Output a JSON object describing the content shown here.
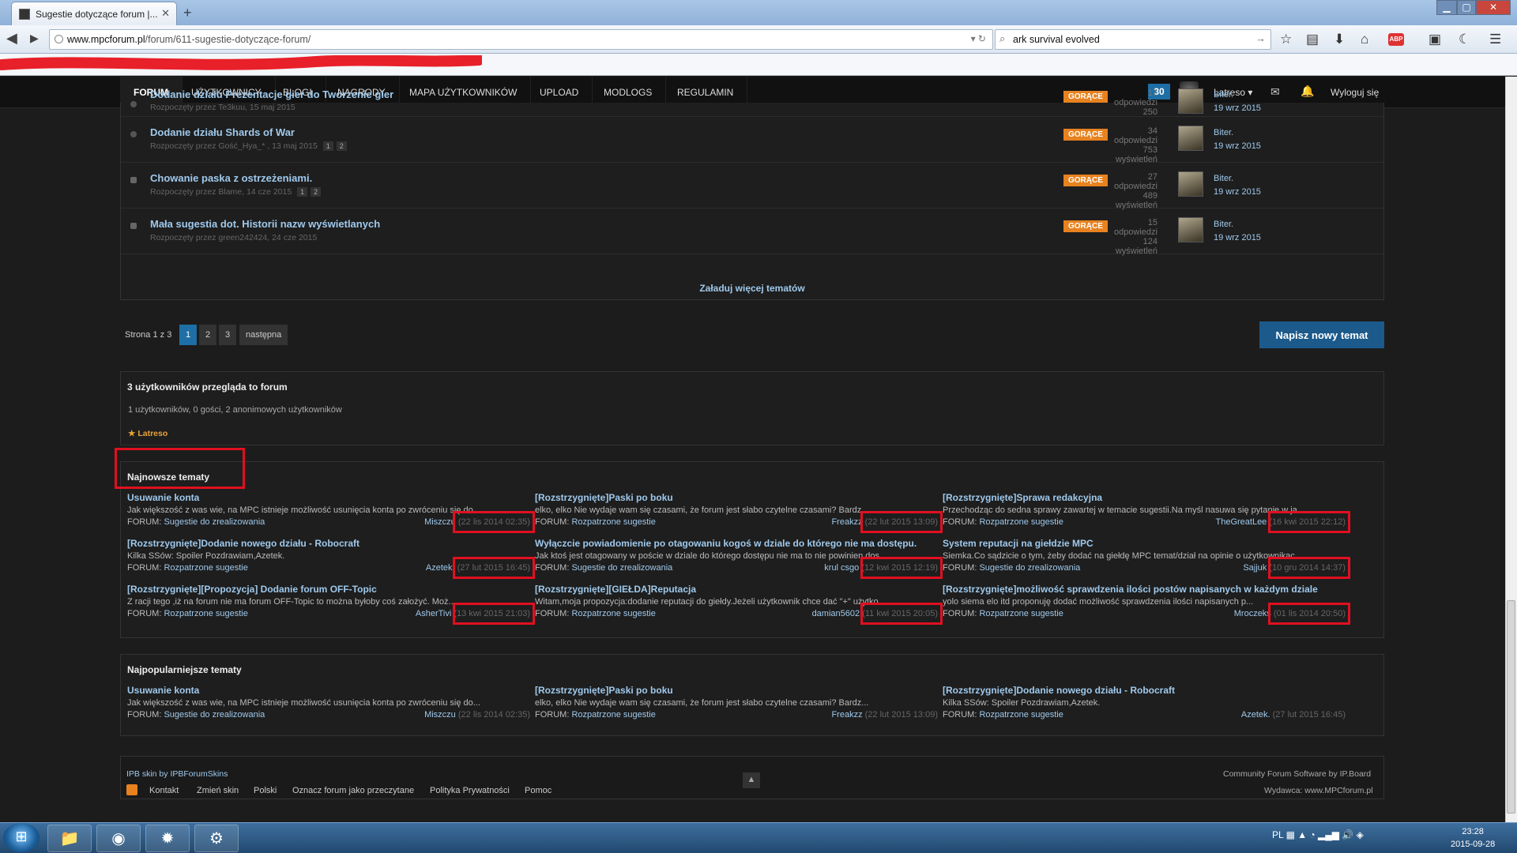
{
  "browser": {
    "tab_title": "Sugestie dotyczące forum |...",
    "tab_close": "✕",
    "new_tab": "+",
    "url_host": "www.mpcforum.pl",
    "url_path": "/forum/611-sugestie-dotyczące-forum/",
    "search_value": "ark survival evolved",
    "win_min": "▁",
    "win_max": "▢",
    "win_close": "✕"
  },
  "nav": {
    "items": [
      "FORUM",
      "UŻYTKOWNICY",
      "BLOGI",
      "NAGRODY",
      "MAPA UŻYTKOWNIKÓW",
      "UPLOAD",
      "MODLOGS",
      "REGULAMIN"
    ],
    "badge": "30",
    "user": "Latreso ▾",
    "logout": "Wyloguj się"
  },
  "topics": [
    {
      "title": "Dodanie działu Prezentacje gier do Tworzenie gier",
      "meta": "Rozpoczęty przez Te3kuu, 15 maj 2015",
      "pages": [],
      "hot": "GORĄCE",
      "replies": "17 odpowiedzi",
      "views": "250 wyświetleń",
      "last_by": "Biter.",
      "last_date": "19 wrz 2015"
    },
    {
      "title": "Dodanie działu Shards of War",
      "meta": "Rozpoczęty przez Gość_Hya_* , 13 maj 2015",
      "pages": [
        "1",
        "2"
      ],
      "hot": "GORĄCE",
      "replies": "34 odpowiedzi",
      "views": "753 wyświetleń",
      "last_by": "Biter.",
      "last_date": "19 wrz 2015"
    },
    {
      "title": "Chowanie paska z ostrzeżeniami.",
      "meta": "Rozpoczęty przez Blame, 14 cze 2015",
      "pages": [
        "1",
        "2"
      ],
      "hot": "GORĄCE",
      "replies": "27 odpowiedzi",
      "views": "489 wyświetleń",
      "last_by": "Biter.",
      "last_date": "19 wrz 2015"
    },
    {
      "title": "Mała sugestia dot. Historii nazw wyświetlanych",
      "meta": "Rozpoczęty przez green242424, 24 cze 2015",
      "pages": [],
      "hot": "GORĄCE",
      "replies": "15 odpowiedzi",
      "views": "124 wyświetleń",
      "last_by": "Biter.",
      "last_date": "19 wrz 2015"
    }
  ],
  "load_more": "Załaduj więcej tematów",
  "pagination": {
    "info": "Strona 1 z 3",
    "pages": [
      "1",
      "2",
      "3"
    ],
    "next": "następna"
  },
  "new_topic_button": "Napisz nowy temat",
  "online": {
    "title": "3 użytkowników przegląda to forum",
    "detail": "1 użytkowników, 0 gości, 2 anonimowych użytkowników",
    "user": "★ Latreso"
  },
  "newest": {
    "title": "Najnowsze tematy",
    "items": [
      {
        "title": "Usuwanie konta",
        "excerpt": "Jak większość z was wie, na MPC istnieje możliwość usunięcia konta po zwróceniu się do...",
        "forum_label": "FORUM: ",
        "forum": "Sugestie do zrealizowania",
        "by": "Miszczu",
        "date": "(22 lis 2014 02:35)"
      },
      {
        "title": "[Rozstrzygnięte]Paski po boku",
        "excerpt": "elko, elko Nie wydaje wam się czasami, że forum jest słabo czytelne czasami? Bardz...",
        "forum_label": "FORUM: ",
        "forum": "Rozpatrzone sugestie",
        "by": "Freakzz",
        "date": "(22 lut 2015 13:09)"
      },
      {
        "title": "[Rozstrzygnięte]Sprawa redakcyjna",
        "excerpt": "Przechodząc do sedna sprawy zawartej w temacie sugestii.Na myśl nasuwa się pytanie w ja...",
        "forum_label": "FORUM: ",
        "forum": "Rozpatrzone sugestie",
        "by": "TheGreatLee",
        "date": "(16 kwi 2015 22:12)"
      },
      {
        "title": "[Rozstrzygnięte]Dodanie nowego działu - Robocraft",
        "excerpt": "Kilka SSów: Spoiler Pozdrawiam,Azetek.",
        "forum_label": "FORUM: ",
        "forum": "Rozpatrzone sugestie",
        "by": "Azetek.",
        "date": "(27 lut 2015 16:45)"
      },
      {
        "title": "Wyłączcie powiadomienie po otagowaniu kogoś w dziale do którego nie ma dostępu.",
        "excerpt": "Jak ktoś jest otagowany w poście w dziale do którego dostępu nie ma to nie powinien dos...",
        "forum_label": "FORUM: ",
        "forum": "Sugestie do zrealizowania",
        "by": "krul csgo",
        "date": "(12 kwi 2015 12:19)"
      },
      {
        "title": "System reputacji na giełdzie MPC",
        "excerpt": "Siemka.Co sądzicie o tym, żeby dodać na giełdę MPC temat/dział na opinie o użytkownikac...",
        "forum_label": "FORUM: ",
        "forum": "Sugestie do zrealizowania",
        "by": "Sajjuk",
        "date": "(10 gru 2014 14:37)"
      },
      {
        "title": "[Rozstrzygnięte][Propozycja] Dodanie forum OFF-Topic",
        "excerpt": "Z racji tego ,iż na forum nie ma forum OFF-Topic to można byłoby coś założyć. Moż...",
        "forum_label": "FORUM: ",
        "forum": "Rozpatrzone sugestie",
        "by": "AsherTivi",
        "date": "(13 kwi 2015 21:03)"
      },
      {
        "title": "[Rozstrzygnięte][GIEŁDA]Reputacja",
        "excerpt": "Witam,moja propozycja:dodanie reputacji do giełdy.Jeżeli użytkownik chce dać \"+\" użytko...",
        "forum_label": "FORUM: ",
        "forum": "Rozpatrzone sugestie",
        "by": "damian5602",
        "date": "(11 kwi 2015 20:05)"
      },
      {
        "title": "[Rozstrzygnięte]możliwość sprawdzenia ilości postów napisanych w każdym dziale",
        "excerpt": "yolo siema elo itd  proponuję dodać możliwość sprawdzenia ilości napisanych p...",
        "forum_label": "FORUM: ",
        "forum": "Rozpatrzone sugestie",
        "by": "Mroczeks",
        "date": "(01 lis 2014 20:50)"
      }
    ]
  },
  "popular": {
    "title": "Najpopularniejsze tematy",
    "items": [
      {
        "title": "Usuwanie konta",
        "excerpt": "Jak większość z was wie, na MPC istnieje możliwość usunięcia konta po zwróceniu się do...",
        "forum_label": "FORUM: ",
        "forum": "Sugestie do zrealizowania",
        "by": "Miszczu",
        "date": "(22 lis 2014 02:35)"
      },
      {
        "title": "[Rozstrzygnięte]Paski po boku",
        "excerpt": "elko, elko Nie wydaje wam się czasami, że forum jest słabo czytelne czasami? Bardz...",
        "forum_label": "FORUM: ",
        "forum": "Rozpatrzone sugestie",
        "by": "Freakzz",
        "date": "(22 lut 2015 13:09)"
      },
      {
        "title": "[Rozstrzygnięte]Dodanie nowego działu - Robocraft",
        "excerpt": "Kilka SSów: Spoiler Pozdrawiam,Azetek.",
        "forum_label": "FORUM: ",
        "forum": "Rozpatrzone sugestie",
        "by": "Azetek.",
        "date": "(27 lut 2015 16:45)"
      }
    ]
  },
  "footer": {
    "skin": "IPB skin by IPBForumSkins",
    "links": [
      "Kontakt",
      "Zmień skin",
      "Polski",
      "Oznacz forum jako przeczytane",
      "Polityka Prywatności",
      "Pomoc"
    ],
    "software": "Community Forum Software by IP.Board",
    "publisher": "Wydawca: www.MPCforum.pl",
    "top": "▲"
  },
  "taskbar": {
    "lang": "PL",
    "time": "23:28",
    "date": "2015-09-28"
  },
  "colors": {
    "accent": "#1d6fa5",
    "hot": "#e8821f",
    "highlight_box": "#e01020",
    "link": "#9fc9ec"
  }
}
